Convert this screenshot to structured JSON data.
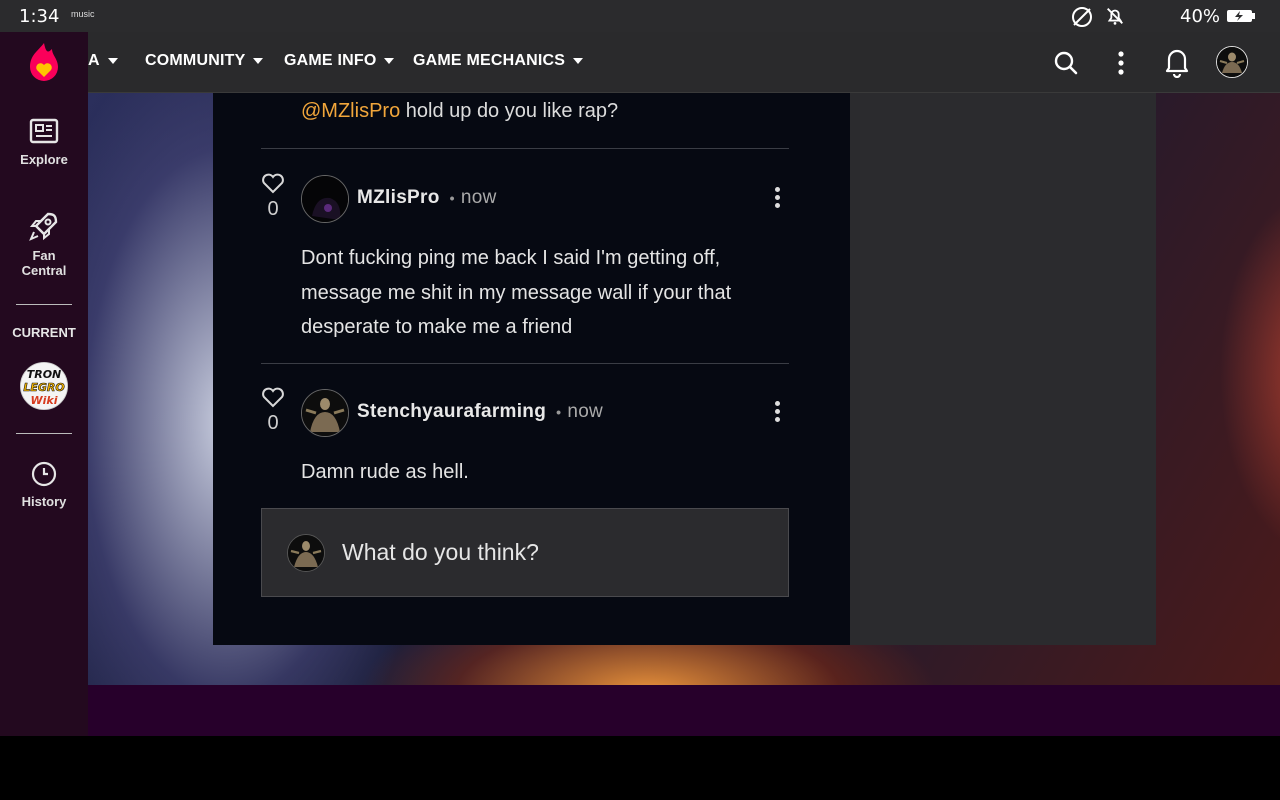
{
  "status_bar": {
    "time": "1:34",
    "music_label": "music",
    "battery_percent": "40%",
    "icons": [
      "no-sync-icon",
      "notifications-off-icon",
      "battery-charging-icon"
    ]
  },
  "sidebar": {
    "items": [
      {
        "label": "Explore",
        "icon": "explore-icon"
      },
      {
        "label": "Fan Central",
        "label_line1": "Fan",
        "label_line2": "Central",
        "icon": "rocket-icon"
      },
      {
        "label": "History",
        "icon": "clock-icon"
      }
    ],
    "current_label": "CURRENT",
    "current_wiki_logo_text": [
      "TRON",
      "LEGRO",
      "Wiki"
    ]
  },
  "topnav": {
    "items": [
      {
        "label": "COMMUNITY"
      },
      {
        "label": "GAME INFO"
      },
      {
        "label": "GAME MECHANICS"
      }
    ],
    "truncated_item_fragment": "A"
  },
  "thread": {
    "previous_reply": {
      "mention": "@MZlisPro",
      "text": "hold up do you like rap?"
    },
    "replies": [
      {
        "likes": "0",
        "username": "MZlisPro",
        "time": "now",
        "text": "Dont fucking ping me back I said I'm getting off, message me shit in my message wall if your that desperate to make me a friend"
      },
      {
        "likes": "0",
        "username": "Stenchyaurafarming",
        "time": "now",
        "text": "Damn rude as hell."
      }
    ],
    "separator_dot": "•"
  },
  "composer": {
    "placeholder": "What do you think?"
  },
  "colors": {
    "mention": "#f1a63b",
    "sidebar_bg": "#23091f",
    "topnav_bg": "#2a2a2c",
    "panel_bg": "#060912",
    "purple_band": "#27002b",
    "fandom_logo": "#fa005a"
  }
}
